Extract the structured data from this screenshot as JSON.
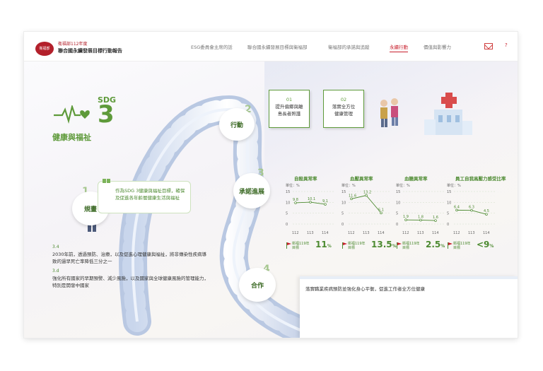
{
  "header": {
    "logo_text": "衛福部",
    "brand_line1": "衛福部112年度",
    "brand_line2": "聯合國永續發展目標行動報告",
    "nav": [
      {
        "label": "ESG委員會主席的話",
        "active": false
      },
      {
        "label": "聯合國永續發展目標與衛福部",
        "active": false
      },
      {
        "label": "衛福部的承諾與追蹤",
        "active": false
      },
      {
        "label": "永續行動",
        "active": true
      },
      {
        "label": "價值與影響力",
        "active": false
      }
    ],
    "help_label": "?"
  },
  "sdg": {
    "label": "SDG",
    "number": "3",
    "title": "健康與福祉"
  },
  "steps": [
    {
      "no": "1",
      "label": "規畫"
    },
    {
      "no": "2",
      "label": "行動"
    },
    {
      "no": "3",
      "label": "承諾進展"
    },
    {
      "no": "4",
      "label": "合作"
    }
  ],
  "plan_text": "作為SDG 3健康與福祉目標，確保及促進各年齡層健康生活與福祉",
  "actions": [
    {
      "no": "01",
      "line1": "提升偏鄉與離",
      "line2": "島長者照護"
    },
    {
      "no": "02",
      "line1": "落實全方位",
      "line2": "健康管理"
    }
  ],
  "targets": [
    {
      "no": "3.4",
      "text": "2030年前，透過預防、治療，以及促進心理健康與福祉，將非傳染性疾病導致的過早死亡率降低三分之一"
    },
    {
      "no": "3.d",
      "text": "強化所有國家的早期預警、減少風險，以及國家與全球健康風險的管理能力，特別是開發中國家"
    }
  ],
  "charts_common": {
    "unit": "單位：%",
    "goal_label_1": "衛福119年",
    "goal_label_2": "目標"
  },
  "chart_data": [
    {
      "type": "line",
      "title": "自殺異常率",
      "categories": [
        "112",
        "113",
        "114"
      ],
      "values": [
        9.8,
        10.1,
        9.1
      ],
      "ylim": [
        0,
        15
      ],
      "yticks": [
        0,
        5,
        10,
        15
      ],
      "goal": "11",
      "goal_unit": "%"
    },
    {
      "type": "line",
      "title": "血壓異常率",
      "categories": [
        "112",
        "113",
        "114"
      ],
      "values": [
        11.6,
        13.2,
        5.1
      ],
      "ylim": [
        0,
        15
      ],
      "yticks": [
        0,
        5,
        10,
        15
      ],
      "goal": "13.5",
      "goal_unit": "%"
    },
    {
      "type": "line",
      "title": "血糖異常率",
      "categories": [
        "112",
        "113",
        "114"
      ],
      "values": [
        1.9,
        1.8,
        1.6
      ],
      "ylim": [
        0,
        15
      ],
      "yticks": [
        0,
        5,
        10,
        15
      ],
      "goal": "2.5",
      "goal_unit": "%"
    },
    {
      "type": "line",
      "title": "員工自我高壓力感受比率",
      "categories": [
        "112",
        "113",
        "114"
      ],
      "values": [
        6.4,
        6.3,
        4.5
      ],
      "ylim": [
        0,
        15
      ],
      "yticks": [
        0,
        5,
        10,
        15
      ],
      "goal": "<9",
      "goal_unit": "%"
    }
  ],
  "cooperation_text": "落實職業疾病預防並強化身心平衡，促進工作者全方位健康",
  "colors": {
    "green": "#5e9a3a",
    "red": "#c8202d"
  }
}
